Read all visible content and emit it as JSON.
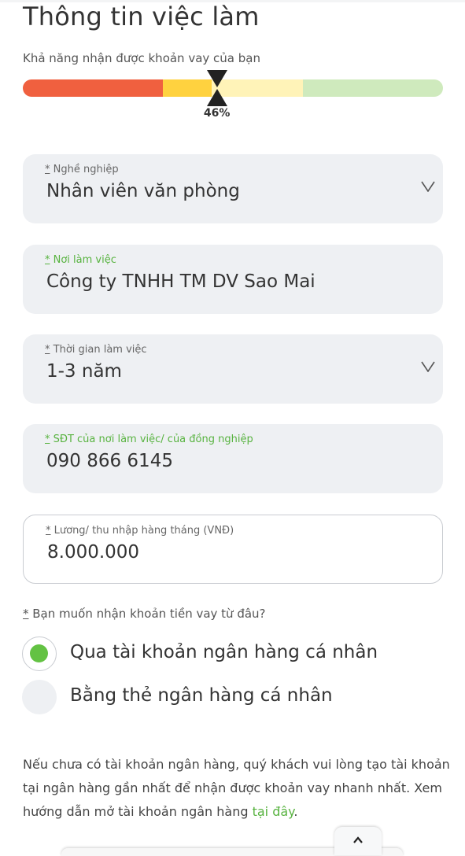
{
  "page": {
    "title": "Thông tin việc làm"
  },
  "meter": {
    "label": "Khả năng nhận được khoản vay của bạn",
    "percent_label": "46%",
    "value_fraction": 0.46,
    "colors": {
      "red": "#f0603f",
      "yellow": "#ffd23f",
      "light_yellow": "#fff3b8",
      "green": "#cfeabd"
    }
  },
  "fields": {
    "occupation": {
      "required": "*",
      "label": " Nghề nghiệp",
      "value": "Nhân viên văn phòng",
      "has_dropdown": true
    },
    "workplace": {
      "required": "*",
      "label": " Nơi làm việc",
      "value": "Công ty TNHH TM DV Sao Mai"
    },
    "work_duration": {
      "required": "*",
      "label": " Thời gian làm việc",
      "value": "1-3 năm",
      "has_dropdown": true
    },
    "workplace_phone": {
      "required": "*",
      "label": " SĐT của nơi làm việc/ của đồng nghiệp",
      "value": "090 866 6145"
    },
    "monthly_income": {
      "required": "*",
      "label": " Lương/ thu nhập hàng tháng (VNĐ)",
      "value": "8.000.000"
    }
  },
  "disbursement": {
    "required": "*",
    "question": " Bạn muốn nhận khoản tiền vay từ đâu?",
    "options": [
      {
        "label": "Qua tài khoản ngân hàng cá nhân",
        "selected": true
      },
      {
        "label": "Bằng thẻ ngân hàng cá nhân",
        "selected": false
      }
    ]
  },
  "note": {
    "text": "Nếu chưa có tài khoản ngân hàng, quý khách vui lòng tạo tài khoản tại ngân hàng gần nhất để nhận được khoản vay nhanh nhất. Xem hướng dẫn mở tài khoản ngân hàng ",
    "link_text": "tại đây",
    "end": "."
  },
  "colors": {
    "accent_green": "#63c243",
    "field_bg": "#eef0f3"
  },
  "icons": {
    "dropdown": "chevron-down-icon",
    "scroll_up": "chevron-up-icon",
    "meter_marker": "hourglass-marker-icon"
  }
}
